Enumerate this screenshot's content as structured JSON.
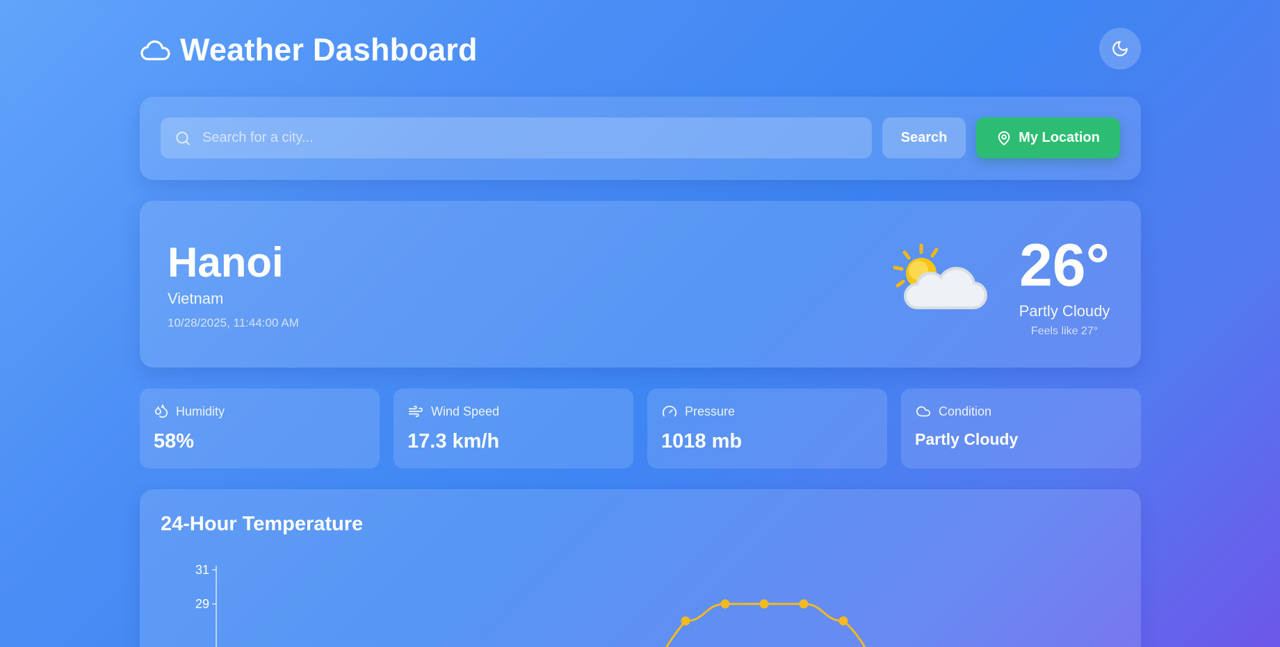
{
  "header": {
    "title": "Weather Dashboard",
    "logo_icon": "cloud-icon",
    "theme_icon": "moon-icon"
  },
  "search": {
    "placeholder": "Search for a city...",
    "value": "",
    "search_label": "Search",
    "location_label": "My Location"
  },
  "current": {
    "city": "Hanoi",
    "country": "Vietnam",
    "datetime": "10/28/2025, 11:44:00 AM",
    "temperature": "26°",
    "condition": "Partly Cloudy",
    "feels_like": "Feels like 27°",
    "icon": "partly-cloudy-icon"
  },
  "stats": [
    {
      "label": "Humidity",
      "value": "58%",
      "icon": "droplet-icon"
    },
    {
      "label": "Wind Speed",
      "value": "17.3 km/h",
      "icon": "wind-icon"
    },
    {
      "label": "Pressure",
      "value": "1018 mb",
      "icon": "gauge-icon"
    },
    {
      "label": "Condition",
      "value": "Partly Cloudy",
      "icon": "cloud-icon"
    }
  ],
  "colors": {
    "accent_green": "#2cbd72",
    "line": "#f5b921"
  },
  "chart_data": {
    "type": "line",
    "title": "24-Hour Temperature",
    "y_ticks": [
      31,
      29
    ],
    "series": [
      {
        "values": [
          28,
          29,
          29,
          29,
          28
        ]
      }
    ]
  }
}
